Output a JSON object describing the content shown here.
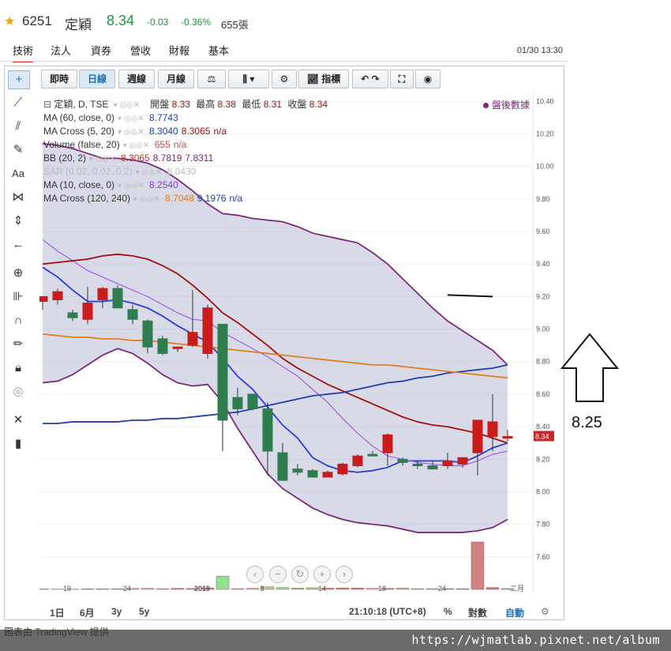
{
  "header": {
    "code": "6251",
    "name": "定穎",
    "price": "8.34",
    "change": "-0.03",
    "change_pct": "-0.36%",
    "volume": "655張"
  },
  "tabs": [
    "技術",
    "法人",
    "資券",
    "營收",
    "財報",
    "基本"
  ],
  "active_tab": "技術",
  "datetime": "01/30 13:30",
  "topbar": {
    "intraday": "即時",
    "daily": "日線",
    "weekly": "週線",
    "monthly": "月線",
    "indicators": "指標"
  },
  "legend": {
    "main": {
      "label": "定穎, D, TSE",
      "open_label": "開盤",
      "open": "8.33",
      "high_label": "最高",
      "high": "8.38",
      "low_label": "最低",
      "low": "8.31",
      "close_label": "收盤",
      "close": "8.34"
    },
    "rows": [
      {
        "label": "MA (60, close, 0)",
        "values": "8.7743",
        "color": "#1f3fa8"
      },
      {
        "label": "MA Cross (5, 20)",
        "values": "8.3040",
        "values2": "8.3065",
        "values3": "n/a",
        "color": "#1f3fa8",
        "color2": "#a01010"
      },
      {
        "label": "Volume (false, 20)",
        "values": "655",
        "values2": "n/a",
        "color": "#c05050"
      },
      {
        "label": "BB (20, 2)",
        "values": "8.3065",
        "values2": "8.7819",
        "values3": "7.8311",
        "color": "#c03030",
        "color2": "#7a2a7a"
      },
      {
        "label": "SAR (0.02, 0.02, 0.2)",
        "values": "8.0430",
        "color": "#bbbbbb"
      },
      {
        "label": "MA (10, close, 0)",
        "values": "8.2540",
        "color": "#8a40d0"
      },
      {
        "label": "MA Cross (120, 240)",
        "values": "8.7048",
        "values2": "9.1976",
        "values3": "n/a",
        "color": "#e08020",
        "color2": "#1f3fa8"
      }
    ]
  },
  "after_hours_badge": "盤後數據",
  "bottombar": {
    "ranges": [
      "1日",
      "6月",
      "3y",
      "5y"
    ],
    "clock": "21:10:18 (UTC+8)",
    "pct": "%",
    "log": "對數",
    "auto": "自動"
  },
  "annotation_value": "8.25",
  "footer_url": "https://wjmatlab.pixnet.net/album",
  "footer_cut_text": "圖表由 TradingView 提供",
  "colors": {
    "up": "#c91c1c",
    "down": "#2e7d4f",
    "band": "#b9bbd3"
  },
  "chart_data": {
    "type": "candlestick",
    "ylim": [
      7.4,
      10.45
    ],
    "yticks": [
      7.6,
      7.8,
      8.0,
      8.2,
      8.4,
      8.6,
      8.8,
      9.0,
      9.2,
      9.4,
      9.6,
      9.8,
      10.0,
      10.2,
      10.4
    ],
    "xtick_labels": [
      "19",
      "24",
      "2019",
      "8",
      "14",
      "18",
      "24",
      "二月"
    ],
    "last_price_label": "8.34",
    "candles": [
      {
        "o": 9.17,
        "h": 9.2,
        "l": 9.12,
        "c": 9.2
      },
      {
        "o": 9.18,
        "h": 9.25,
        "l": 9.15,
        "c": 9.23
      },
      {
        "o": 9.1,
        "h": 9.12,
        "l": 9.05,
        "c": 9.07
      },
      {
        "o": 9.06,
        "h": 9.26,
        "l": 9.03,
        "c": 9.16
      },
      {
        "o": 9.18,
        "h": 9.26,
        "l": 9.13,
        "c": 9.25
      },
      {
        "o": 9.25,
        "h": 9.27,
        "l": 9.13,
        "c": 9.13
      },
      {
        "o": 9.12,
        "h": 9.15,
        "l": 9.03,
        "c": 9.06
      },
      {
        "o": 9.05,
        "h": 9.06,
        "l": 8.85,
        "c": 8.89
      },
      {
        "o": 8.94,
        "h": 8.96,
        "l": 8.84,
        "c": 8.85
      },
      {
        "o": 8.88,
        "h": 8.89,
        "l": 8.86,
        "c": 8.89
      },
      {
        "o": 8.9,
        "h": 9.24,
        "l": 8.89,
        "c": 8.98
      },
      {
        "o": 8.85,
        "h": 9.15,
        "l": 8.82,
        "c": 9.13
      },
      {
        "o": 9.03,
        "h": 9.03,
        "l": 8.25,
        "c": 8.44
      },
      {
        "o": 8.58,
        "h": 8.64,
        "l": 8.47,
        "c": 8.51
      },
      {
        "o": 8.6,
        "h": 8.6,
        "l": 8.5,
        "c": 8.51
      },
      {
        "o": 8.51,
        "h": 8.55,
        "l": 8.1,
        "c": 8.25
      },
      {
        "o": 8.24,
        "h": 8.3,
        "l": 8.07,
        "c": 8.07
      },
      {
        "o": 8.14,
        "h": 8.17,
        "l": 8.1,
        "c": 8.12
      },
      {
        "o": 8.13,
        "h": 8.14,
        "l": 8.1,
        "c": 8.09
      },
      {
        "o": 8.09,
        "h": 8.13,
        "l": 8.09,
        "c": 8.12
      },
      {
        "o": 8.11,
        "h": 8.18,
        "l": 8.1,
        "c": 8.17
      },
      {
        "o": 8.16,
        "h": 8.23,
        "l": 8.15,
        "c": 8.22
      },
      {
        "o": 8.23,
        "h": 8.25,
        "l": 8.22,
        "c": 8.22
      },
      {
        "o": 8.24,
        "h": 8.36,
        "l": 8.16,
        "c": 8.35
      },
      {
        "o": 8.2,
        "h": 8.21,
        "l": 8.16,
        "c": 8.18
      },
      {
        "o": 8.17,
        "h": 8.19,
        "l": 8.14,
        "c": 8.16
      },
      {
        "o": 8.16,
        "h": 8.19,
        "l": 8.14,
        "c": 8.14
      },
      {
        "o": 8.16,
        "h": 8.24,
        "l": 8.14,
        "c": 8.19
      },
      {
        "o": 8.17,
        "h": 8.21,
        "l": 8.15,
        "c": 8.21
      },
      {
        "o": 8.24,
        "h": 8.44,
        "l": 8.1,
        "c": 8.44
      },
      {
        "o": 8.34,
        "h": 8.6,
        "l": 8.25,
        "c": 8.43
      },
      {
        "o": 8.33,
        "h": 8.38,
        "l": 8.31,
        "c": 8.34
      }
    ],
    "volume": [
      5,
      3,
      3,
      6,
      6,
      8,
      12,
      14,
      10,
      14,
      12,
      20,
      180,
      10,
      14,
      35,
      25,
      18,
      22,
      16,
      20,
      18,
      14,
      12,
      18,
      10,
      10,
      10,
      8,
      640,
      25,
      10
    ],
    "series": [
      {
        "name": "MA 5",
        "color": "#2a3fd8",
        "values": [
          9.38,
          9.32,
          9.24,
          9.17,
          9.17,
          9.18,
          9.16,
          9.13,
          9.08,
          9.02,
          8.97,
          8.92,
          8.82,
          8.71,
          8.63,
          8.52,
          8.41,
          8.33,
          8.21,
          8.16,
          8.13,
          8.12,
          8.13,
          8.15,
          8.19,
          8.19,
          8.19,
          8.19,
          8.18,
          8.22,
          8.27,
          8.3
        ]
      },
      {
        "name": "MA 10",
        "color": "#a060e0",
        "values": [
          9.55,
          9.48,
          9.42,
          9.36,
          9.32,
          9.28,
          9.24,
          9.2,
          9.15,
          9.1,
          9.06,
          9.05,
          8.98,
          8.93,
          8.88,
          8.83,
          8.77,
          8.71,
          8.63,
          8.55,
          8.45,
          8.36,
          8.28,
          8.22,
          8.2,
          8.18,
          8.17,
          8.16,
          8.16,
          8.19,
          8.23,
          8.25
        ]
      },
      {
        "name": "MA 20",
        "color": "#a01010",
        "values": [
          9.4,
          9.41,
          9.42,
          9.43,
          9.45,
          9.46,
          9.45,
          9.43,
          9.39,
          9.34,
          9.27,
          9.19,
          9.1,
          9.04,
          8.97,
          8.9,
          8.82,
          8.76,
          8.71,
          8.66,
          8.62,
          8.58,
          8.54,
          8.5,
          8.46,
          8.43,
          8.41,
          8.4,
          8.38,
          8.36,
          8.33,
          8.3
        ]
      },
      {
        "name": "MA 60",
        "color": "#1f3fa8",
        "values": [
          8.42,
          8.42,
          8.43,
          8.43,
          8.43,
          8.43,
          8.44,
          8.44,
          8.45,
          8.45,
          8.46,
          8.47,
          8.48,
          8.49,
          8.51,
          8.53,
          8.55,
          8.57,
          8.59,
          8.6,
          8.61,
          8.63,
          8.65,
          8.67,
          8.68,
          8.7,
          8.71,
          8.73,
          8.74,
          8.75,
          8.76,
          8.78
        ]
      },
      {
        "name": "MA 120",
        "color": "#e08020",
        "values": [
          8.97,
          8.96,
          8.95,
          8.95,
          8.94,
          8.94,
          8.93,
          8.93,
          8.92,
          8.91,
          8.9,
          8.89,
          8.88,
          8.87,
          8.86,
          8.85,
          8.84,
          8.83,
          8.82,
          8.81,
          8.8,
          8.79,
          8.78,
          8.78,
          8.77,
          8.76,
          8.75,
          8.74,
          8.73,
          8.72,
          8.71,
          8.7
        ]
      },
      {
        "name": "BB upper",
        "color": "#7a2a7a",
        "values": [
          10.14,
          10.13,
          10.11,
          10.08,
          10.05,
          10.05,
          10.04,
          10.02,
          9.98,
          9.92,
          9.85,
          9.77,
          9.71,
          9.7,
          9.68,
          9.67,
          9.66,
          9.63,
          9.59,
          9.57,
          9.55,
          9.53,
          9.47,
          9.4,
          9.31,
          9.22,
          9.13,
          9.05,
          8.99,
          8.93,
          8.87,
          8.78
        ]
      },
      {
        "name": "BB lower",
        "color": "#7a2a7a",
        "values": [
          8.67,
          8.68,
          8.72,
          8.78,
          8.84,
          8.88,
          8.85,
          8.79,
          8.72,
          8.67,
          8.65,
          8.66,
          8.55,
          8.39,
          8.25,
          8.11,
          8.02,
          7.96,
          7.9,
          7.86,
          7.83,
          7.81,
          7.8,
          7.79,
          7.77,
          7.75,
          7.75,
          7.75,
          7.75,
          7.76,
          7.78,
          7.83
        ]
      }
    ],
    "trend_marker": [
      {
        "x": 27,
        "y": 9.21
      },
      {
        "x": 30,
        "y": 9.2
      }
    ]
  }
}
